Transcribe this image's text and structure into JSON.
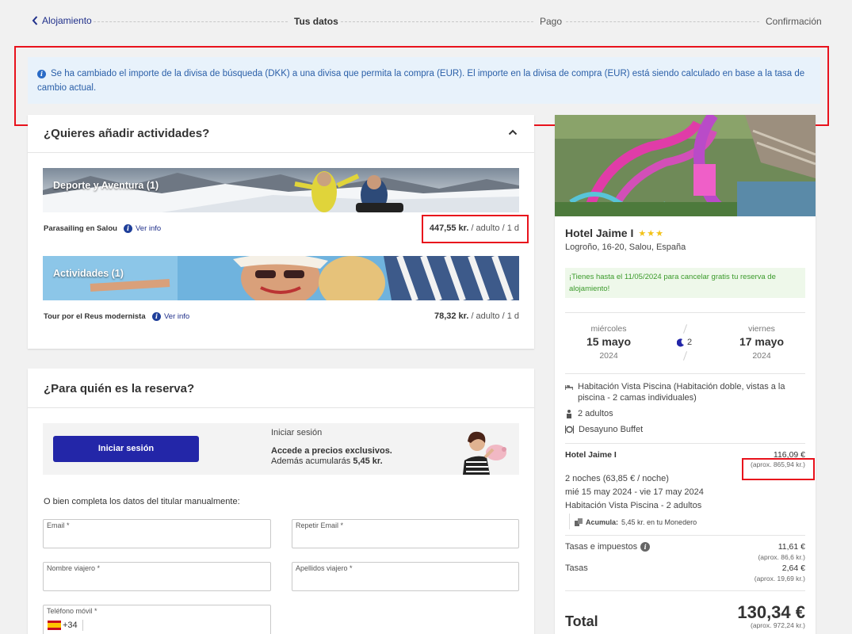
{
  "stepper": {
    "back_label": "Alojamiento",
    "steps": [
      "Tus datos",
      "Pago",
      "Confirmación"
    ]
  },
  "alert": {
    "text": "Se ha cambiado el importe de la divisa de búsqueda (DKK) a una divisa que permita la compra (EUR). El importe en la divisa de compra (EUR) está siendo calculado en base a la tasa de cambio actual."
  },
  "activities": {
    "title": "¿Quieres añadir actividades?",
    "groups": [
      {
        "banner": "Deporte y Aventura (1)",
        "name": "Parasailing en Salou",
        "info": "Ver info",
        "price": "447,55 kr.",
        "unit": " / adulto / 1 d"
      },
      {
        "banner": "Actividades (1)",
        "name": "Tour por el Reus modernista",
        "info": "Ver info",
        "price": "78,32 kr.",
        "unit": " / adulto / 1 d"
      }
    ]
  },
  "booking": {
    "title": "¿Para quién es la reserva?",
    "login_button": "Iniciar sesión",
    "login_heading": "Iniciar sesión",
    "login_promo": "Accede a precios exclusivos.",
    "login_earn_prefix": "Además acumularás ",
    "login_earn_amount": "5,45 kr.",
    "manual_label": "O bien completa los datos del titular manualmente:",
    "fields": {
      "email": "Email *",
      "repeat_email": "Repetir Email *",
      "first_name": "Nombre viajero *",
      "last_name": "Apellidos viajero *",
      "phone": "Teléfono móvil *",
      "phone_prefix": "+34"
    }
  },
  "hotel": {
    "name": "Hotel Jaime I",
    "stars": 3,
    "address": "Logroño, 16-20, Salou, España",
    "cancel_note": "¡Tienes hasta el 11/05/2024 para cancelar gratis tu reserva de alojamiento!",
    "checkin": {
      "weekday": "miércoles",
      "date": "15 mayo",
      "year": "2024"
    },
    "checkout": {
      "weekday": "viernes",
      "date": "17 mayo",
      "year": "2024"
    },
    "nights": "2",
    "room": "Habitación Vista Piscina (Habitación doble, vistas a la piscina - 2 camas individuales)",
    "guests": "2 adultos",
    "board": "Desayuno Buffet"
  },
  "summary": {
    "hotel_label": "Hotel Jaime I",
    "hotel_price": "116,09 €",
    "hotel_approx": "(aprox. 865,94 kr.)",
    "nights_line": "2 noches (63,85 € / noche)",
    "dates_line": "mié 15 may 2024 - vie 17 may 2024",
    "room_line": "Habitación Vista Piscina - 2 adultos",
    "earn_label": "Acumula:",
    "earn_text": " 5,45 kr. en tu Monedero",
    "taxes_label": "Tasas e impuestos",
    "taxes_price": "11,61 €",
    "taxes_approx": "(aprox. 86,6 kr.)",
    "fees_label": "Tasas",
    "fees_price": "2,64 €",
    "fees_approx": "(aprox. 19,69 kr.)",
    "total_label": "Total",
    "total_price": "130,34 €",
    "total_approx": "(aprox. 972,24 kr.)"
  },
  "colors": {
    "accent": "#2326a8",
    "alert_text": "#2a5fa8",
    "highlight": "#e8121c",
    "success": "#3a9a2a"
  }
}
